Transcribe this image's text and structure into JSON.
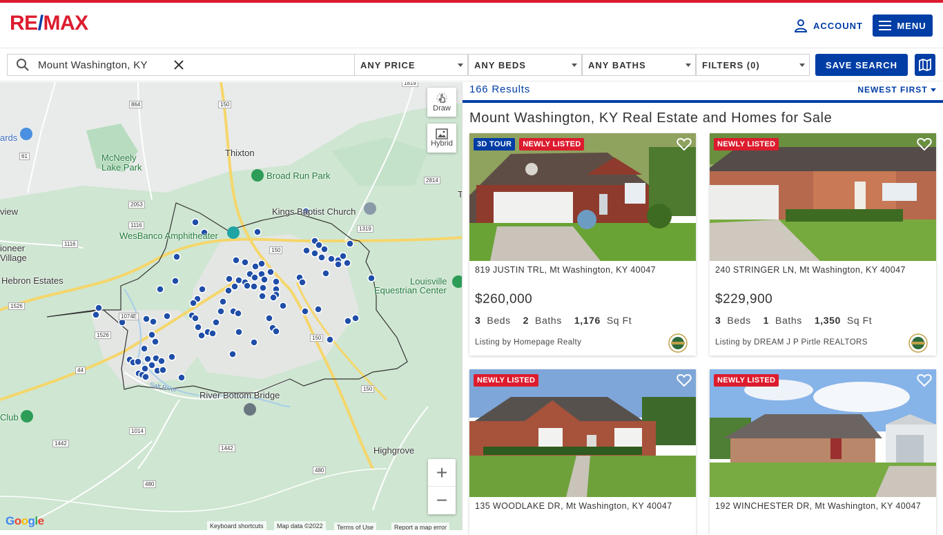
{
  "brand": {
    "logo_left": "RE",
    "logo_slash": "/",
    "logo_right": "MAX",
    "primary": "#dc1c2e",
    "accent": "#003da5"
  },
  "header": {
    "account_label": "ACCOUNT",
    "menu_label": "MENU"
  },
  "search": {
    "value": "Mount Washington, KY"
  },
  "filters": {
    "price": "ANY PRICE",
    "beds": "ANY BEDS",
    "baths": "ANY BATHS",
    "filters": "FILTERS (0)",
    "save_search": "SAVE SEARCH"
  },
  "map": {
    "controls": {
      "draw": "Draw",
      "hybrid": "Hybrid",
      "zoom_in": "+",
      "zoom_out": "−"
    },
    "labels": {
      "thixton": "Thixton",
      "broad_run": "Broad Run Park",
      "kings_baptist": "Kings Baptist Church",
      "mcneely": "McNeely",
      "mcneely2": "Lake Park",
      "wesbanco": "WesBanco Amphitheater",
      "louisville1": "Louisville",
      "louisville2": "Equestrian Center",
      "hebron": "Hebron Estates",
      "pioneer1": "ioneer",
      "pioneer2": "Village",
      "view": "view",
      "ards": "ards",
      "club": "Club",
      "river_bottom": "River Bottom Bridge",
      "highgrove": "Highgrove",
      "salt_river": "Salt River",
      "t": "T"
    },
    "route_shields": {
      "r864": "864",
      "r150a": "150",
      "r1819": "1819",
      "r2053": "2053",
      "r1116a": "1116",
      "r1116b": "1116",
      "r61": "61",
      "r2814": "2814",
      "r1319": "1319",
      "r150b": "150",
      "r1526a": "1526",
      "r1526b": "1526",
      "r1074e": "1074E",
      "r44": "44",
      "r150c": "150",
      "r150d": "150",
      "r1014": "1014",
      "r1442a": "1442",
      "r1442b": "1442",
      "r480a": "480",
      "r480b": "480"
    },
    "google": "Google",
    "attrib": {
      "keys": "Keyboard shortcuts",
      "mapdata": "Map data ©2022",
      "terms": "Terms of Use",
      "report": "Report a map error"
    }
  },
  "results": {
    "count": "166 Results",
    "sort": "NEWEST FIRST",
    "title": "Mount Washington, KY Real Estate and Homes for Sale"
  },
  "listings": [
    {
      "badges": [
        "3D TOUR",
        "NEWLY LISTED"
      ],
      "address": "819 JUSTIN TRL, Mt Washington, KY 40047",
      "price": "$260,000",
      "beds": "3",
      "beds_label": "Beds",
      "baths": "2",
      "baths_label": "Baths",
      "sqft": "1,176",
      "sqft_label": "Sq Ft",
      "agent": "Listing by Homepage Realty"
    },
    {
      "badges": [
        "NEWLY LISTED"
      ],
      "address": "240 STRINGER LN, Mt Washington, KY 40047",
      "price": "$229,900",
      "beds": "3",
      "beds_label": "Beds",
      "baths": "1",
      "baths_label": "Baths",
      "sqft": "1,350",
      "sqft_label": "Sq Ft",
      "agent": "Listing by DREAM J P Pirtle REALTORS"
    },
    {
      "badges": [
        "NEWLY LISTED"
      ],
      "address": "135 WOODLAKE DR, Mt Washington, KY 40047"
    },
    {
      "badges": [
        "NEWLY LISTED"
      ],
      "address": "192 WINCHESTER DR, Mt Washington, KY 40047"
    }
  ]
}
